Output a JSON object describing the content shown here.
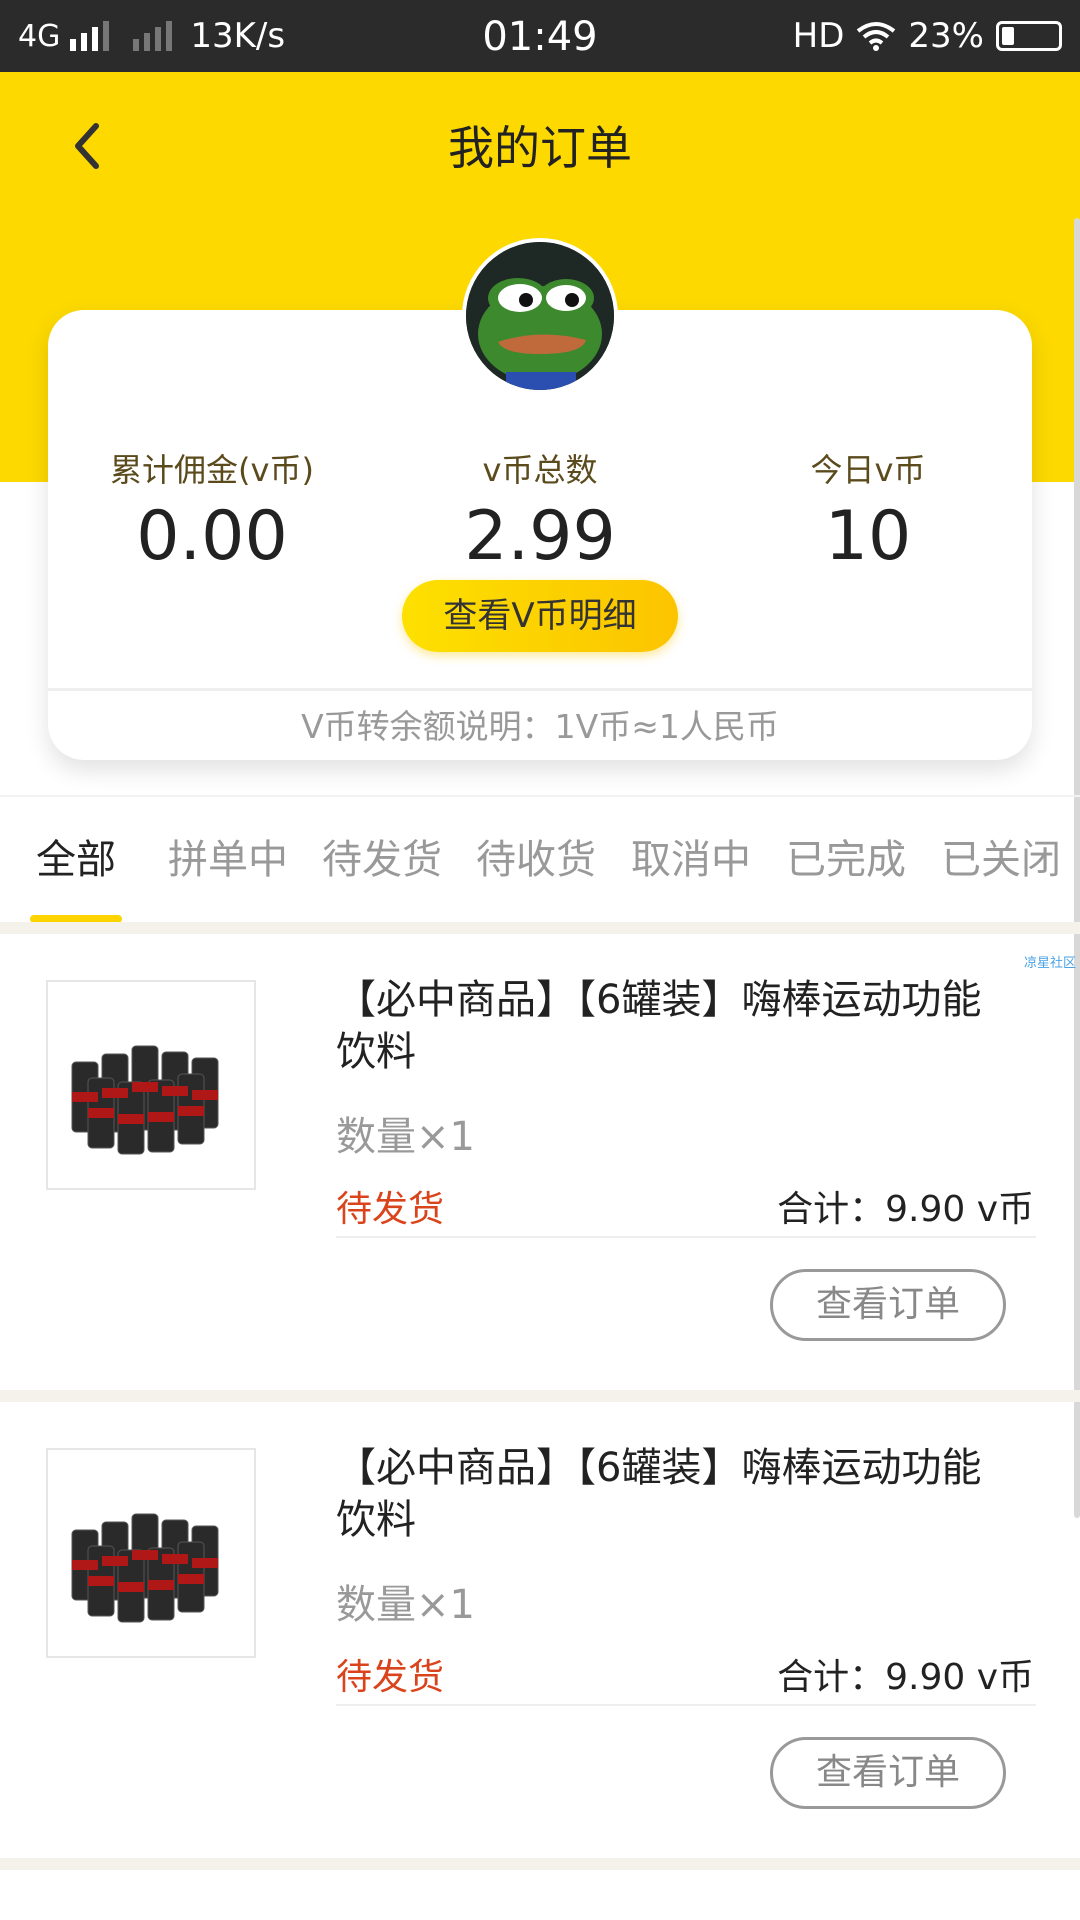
{
  "status_bar": {
    "network": "4G",
    "speed": "13K/s",
    "time": "01:49",
    "hd": "HD",
    "battery": "23%",
    "battery_level": 0.23
  },
  "header": {
    "title": "我的订单"
  },
  "summary": {
    "stats": [
      {
        "label": "累计佣金(v币)",
        "value": "0.00"
      },
      {
        "label": "v币总数",
        "value": "2.99"
      },
      {
        "label": "今日v币",
        "value": "10"
      }
    ],
    "detail_button": "查看V币明细",
    "note": "V币转余额说明：1V币≈1人民币"
  },
  "tabs": [
    "全部",
    "拼单中",
    "待发货",
    "待收货",
    "取消中",
    "已完成",
    "已关闭"
  ],
  "active_tab": "全部",
  "watermark": "凉星社区",
  "orders": [
    {
      "title": "【必中商品】【6罐装】嗨棒运动功能饮料",
      "quantity": "数量×1",
      "status": "待发货",
      "total": "合计：9.90 v币",
      "button": "查看订单"
    },
    {
      "title": "【必中商品】【6罐装】嗨棒运动功能饮料",
      "quantity": "数量×1",
      "status": "待发货",
      "total": "合计：9.90 v币",
      "button": "查看订单"
    }
  ],
  "colors": {
    "brand_yellow": "#fdd900",
    "status_red": "#d9441c"
  }
}
